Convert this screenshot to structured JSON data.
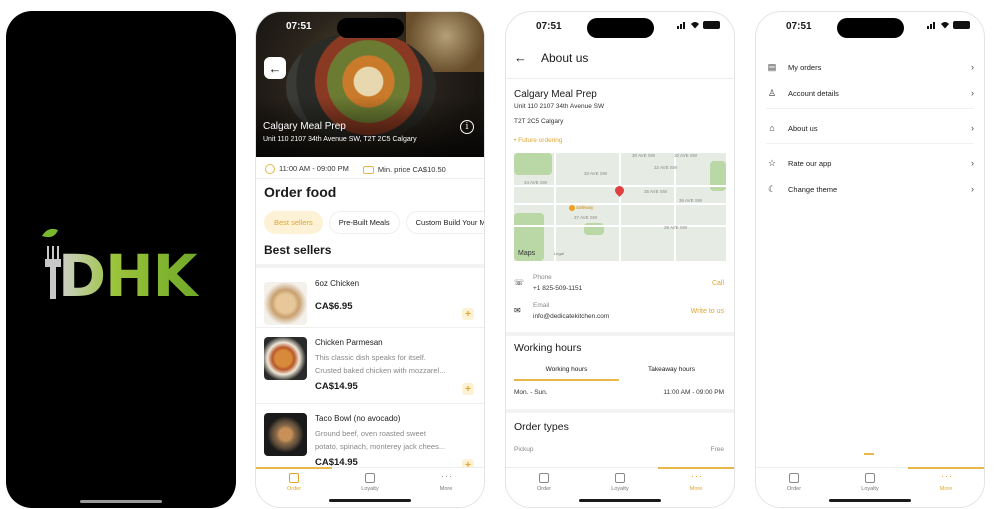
{
  "splash": {
    "logo_text": "DHK"
  },
  "status_time": "07:51",
  "restaurant": {
    "name": "Calgary Meal Prep",
    "address": "Unit 110 2107 34th Avenue SW, T2T 2C5 Calgary",
    "hours": "11:00 AM - 09:00 PM",
    "min_price": "Min. price CA$10.50"
  },
  "order": {
    "title": "Order food",
    "chips": [
      "Best sellers",
      "Pre-Built Meals",
      "Custom Build Your M"
    ],
    "section": "Best sellers",
    "items": [
      {
        "name": "6oz Chicken",
        "desc1": "",
        "desc2": "",
        "price": "CA$6.95"
      },
      {
        "name": "Chicken Parmesan",
        "desc1": "This classic dish speaks for itself.",
        "desc2": "Crusted baked chicken with mozzarel...",
        "price": "CA$14.95"
      },
      {
        "name": "Taco Bowl (no avocado)",
        "desc1": "Ground beef, oven roasted sweet",
        "desc2": "potato, spinach, monterey jack chees...",
        "price": "CA$14.95"
      }
    ]
  },
  "tabs": {
    "order": "Order",
    "loyalty": "Loyalty",
    "more": "More"
  },
  "about": {
    "title": "About us",
    "name": "Calgary Meal Prep",
    "addr1": "Unit 110 2107 34th Avenue SW",
    "addr2": "T2T 2C5 Calgary",
    "future": "Future ordering",
    "map": {
      "labels": [
        "30 AVE SW",
        "30 AVE SW",
        "32 AVE SW",
        "33 AVE SW",
        "34 AVE SW",
        "35 AVE SW",
        "36 AVE SW",
        "37 AVE SW",
        "38 AVE SW",
        "Safeway"
      ],
      "logo": "Maps",
      "legal": "Legal"
    },
    "phone_label": "Phone",
    "phone": "+1 825-509-1151",
    "phone_action": "Call",
    "email_label": "Email",
    "email": "info@dedicatekitchen.com",
    "email_action": "Write to us",
    "working_hours_title": "Working hours",
    "wh_tabs": [
      "Working hours",
      "Takeaway hours"
    ],
    "wh_day": "Mon. - Sun.",
    "wh_time": "11:00 AM - 09:00 PM",
    "order_types_title": "Order types",
    "ot_name": "Pickup",
    "ot_price": "Free"
  },
  "more_menu": [
    {
      "label": "My orders",
      "icon": "receipt-icon"
    },
    {
      "label": "Account details",
      "icon": "user-icon"
    },
    {
      "label": "About us",
      "icon": "home-icon"
    },
    {
      "label": "Rate our app",
      "icon": "star-icon"
    },
    {
      "label": "Change theme",
      "icon": "moon-icon"
    }
  ],
  "colors": {
    "accent": "#e8b84a",
    "logo_green": "#8dc63f"
  }
}
